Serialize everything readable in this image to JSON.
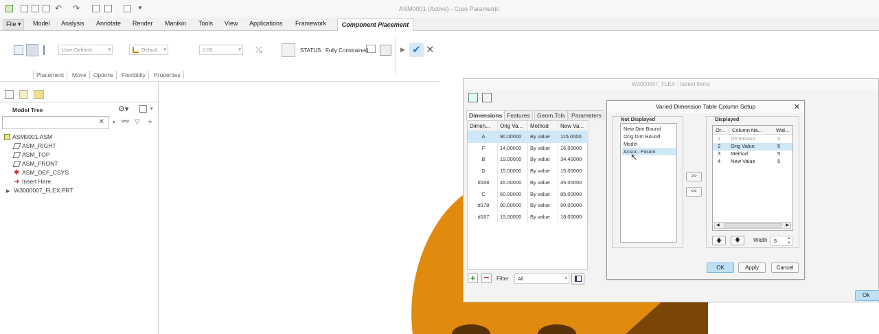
{
  "app": {
    "title": "ASM0001 (Active) - Creo Parametric"
  },
  "menu_tabs": [
    "File",
    "Model",
    "Analysis",
    "Annotate",
    "Render",
    "Manikin",
    "Tools",
    "View",
    "Applications",
    "Framework",
    "Component Placement"
  ],
  "ribbon": {
    "constraint_set": "User Defined",
    "constraint": "Default",
    "offset": "0.00",
    "status": "STATUS : Fully Constrained",
    "sub_tabs": [
      "Placement",
      "Move",
      "Options",
      "Flexibility",
      "Properties"
    ]
  },
  "model_tree": {
    "title": "Model Tree",
    "items": [
      "ASM0001.ASM",
      "ASM_RIGHT",
      "ASM_TOP",
      "ASM_FRONT",
      "ASM_DEF_CSYS",
      "Insert Here",
      "W3000007_FLEX.PRT"
    ]
  },
  "varied_items": {
    "title": "W3000007_FLEX : Varied Items",
    "tabs": [
      "Dimensions",
      "Features",
      "Geom.Tols",
      "Parameters"
    ],
    "columns": [
      "Dimen...",
      "Orig Va...",
      "Method",
      "New Va..."
    ],
    "rows": [
      [
        "A",
        "90.00000",
        "By value",
        "115.0000"
      ],
      [
        "F",
        "14.00000",
        "By value",
        "16.00000"
      ],
      [
        "B",
        "19.00000",
        "By value",
        "34.40000"
      ],
      [
        "D",
        "15.00000",
        "By value",
        "15.00000"
      ],
      [
        "d168",
        "45.00000",
        "By value",
        "45.00000"
      ],
      [
        "C",
        "60.00000",
        "By value",
        "85.00000"
      ],
      [
        "d178",
        "90.00000",
        "By value",
        "90.00000"
      ],
      [
        "d187",
        "15.00000",
        "By value",
        "18.00000"
      ]
    ],
    "filter_label": "Filter",
    "filter_value": "All",
    "ok_partial": "Ok"
  },
  "column_setup": {
    "title": "Varied Dimension Table Column Setup",
    "not_displayed_label": "Not Displayed",
    "not_displayed": [
      "New Dim Bound",
      "Orig Dim Bound",
      "Model",
      "Assoc. Param"
    ],
    "displayed_label": "Displayed",
    "displayed_columns": [
      "Or...",
      "Column Na...",
      "Wid..."
    ],
    "displayed_rows": [
      [
        "1",
        "Dimension",
        "5"
      ],
      [
        "2",
        "Orig Value",
        "5"
      ],
      [
        "3",
        "Method",
        "5"
      ],
      [
        "4",
        "New Value",
        "5"
      ]
    ],
    "move_right": ">>",
    "move_left": "<<",
    "width_label": "Width",
    "width_value": "5",
    "ok": "OK",
    "apply": "Apply",
    "cancel": "Cancel"
  },
  "colors": {
    "part": "#e08a0e",
    "part_shadow": "#6a3a08",
    "selection": "#cfe8f8",
    "accept_check": "#2f7fc0"
  }
}
